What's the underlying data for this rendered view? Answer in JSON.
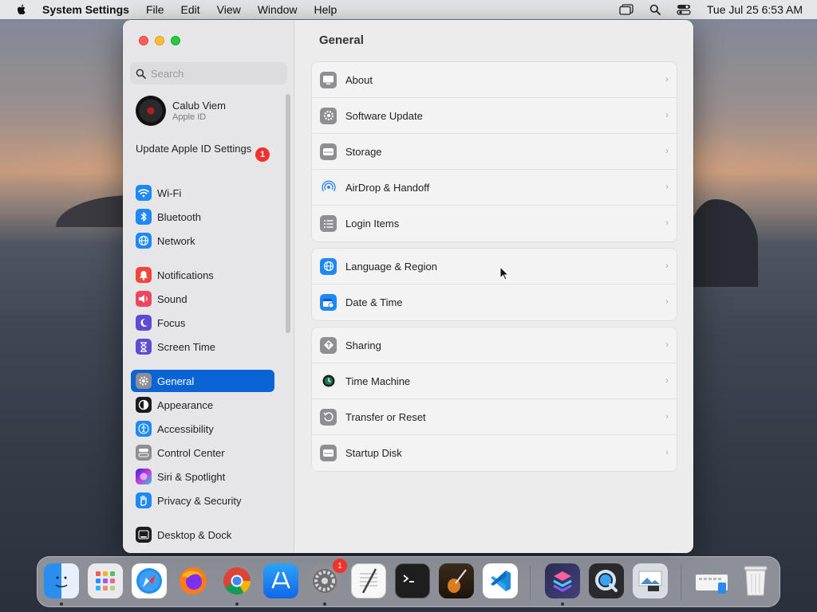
{
  "menubar": {
    "app_name": "System Settings",
    "menus": [
      "File",
      "Edit",
      "View",
      "Window",
      "Help"
    ],
    "clock": "Tue Jul 25  6:53 AM"
  },
  "sidebar": {
    "search_placeholder": "Search",
    "profile": {
      "name": "Calub Viem",
      "subtitle": "Apple ID"
    },
    "update_label": "Update Apple ID Settings",
    "update_badge": "1",
    "items": [
      {
        "label": "Wi-Fi",
        "icon": "wifi-icon",
        "color": "#1e88f5"
      },
      {
        "label": "Bluetooth",
        "icon": "bluetooth-icon",
        "color": "#1e88f5"
      },
      {
        "label": "Network",
        "icon": "globe-icon",
        "color": "#1e88f5"
      },
      {
        "label": "Notifications",
        "icon": "bell-icon",
        "color": "#f3453c"
      },
      {
        "label": "Sound",
        "icon": "speaker-icon",
        "color": "#f0455e"
      },
      {
        "label": "Focus",
        "icon": "moon-icon",
        "color": "#5c4bd4"
      },
      {
        "label": "Screen Time",
        "icon": "hourglass-icon",
        "color": "#5c4bd4"
      },
      {
        "label": "General",
        "icon": "gear-icon",
        "color": "#8e8e93"
      },
      {
        "label": "Appearance",
        "icon": "appearance-icon",
        "color": "#1c1c1e"
      },
      {
        "label": "Accessibility",
        "icon": "accessibility-icon",
        "color": "#1e88f5"
      },
      {
        "label": "Control Center",
        "icon": "control-center-icon",
        "color": "#8e8e93"
      },
      {
        "label": "Siri & Spotlight",
        "icon": "siri-icon",
        "color": "#7a4be0"
      },
      {
        "label": "Privacy & Security",
        "icon": "hand-icon",
        "color": "#1e88f5"
      },
      {
        "label": "Desktop & Dock",
        "icon": "dock-icon",
        "color": "#1c1c1e"
      }
    ]
  },
  "content": {
    "title": "General",
    "groups": [
      [
        {
          "label": "About",
          "icon": "display-icon"
        },
        {
          "label": "Software Update",
          "icon": "gear-badge-icon"
        },
        {
          "label": "Storage",
          "icon": "drive-icon"
        },
        {
          "label": "AirDrop & Handoff",
          "icon": "airdrop-icon"
        },
        {
          "label": "Login Items",
          "icon": "list-icon"
        }
      ],
      [
        {
          "label": "Language & Region",
          "icon": "globe-icon"
        },
        {
          "label": "Date & Time",
          "icon": "calendar-clock-icon"
        }
      ],
      [
        {
          "label": "Sharing",
          "icon": "sharing-icon"
        },
        {
          "label": "Time Machine",
          "icon": "time-machine-icon"
        },
        {
          "label": "Transfer or Reset",
          "icon": "reset-icon"
        },
        {
          "label": "Startup Disk",
          "icon": "disk-icon"
        }
      ]
    ]
  },
  "dock": {
    "apps": [
      {
        "name": "Finder",
        "icon": "finder-icon"
      },
      {
        "name": "Launchpad",
        "icon": "launchpad-icon"
      },
      {
        "name": "Safari",
        "icon": "safari-icon"
      },
      {
        "name": "Firefox",
        "icon": "firefox-icon"
      },
      {
        "name": "Chrome",
        "icon": "chrome-icon"
      },
      {
        "name": "App Store",
        "icon": "app-store-icon"
      },
      {
        "name": "System Settings",
        "icon": "system-settings-icon",
        "badge": "1"
      },
      {
        "name": "TextEdit",
        "icon": "textedit-icon"
      },
      {
        "name": "Terminal",
        "icon": "terminal-icon"
      },
      {
        "name": "Instruments",
        "icon": "guitar-icon"
      },
      {
        "name": "VS Code",
        "icon": "vscode-icon"
      },
      {
        "name": "Shortcuts",
        "icon": "shortcuts-icon"
      },
      {
        "name": "QuickTime",
        "icon": "quicktime-icon"
      },
      {
        "name": "Preview",
        "icon": "preview-icon"
      },
      {
        "name": "Downloads",
        "icon": "downloads-folder-icon"
      },
      {
        "name": "Trash",
        "icon": "trash-icon"
      }
    ]
  }
}
